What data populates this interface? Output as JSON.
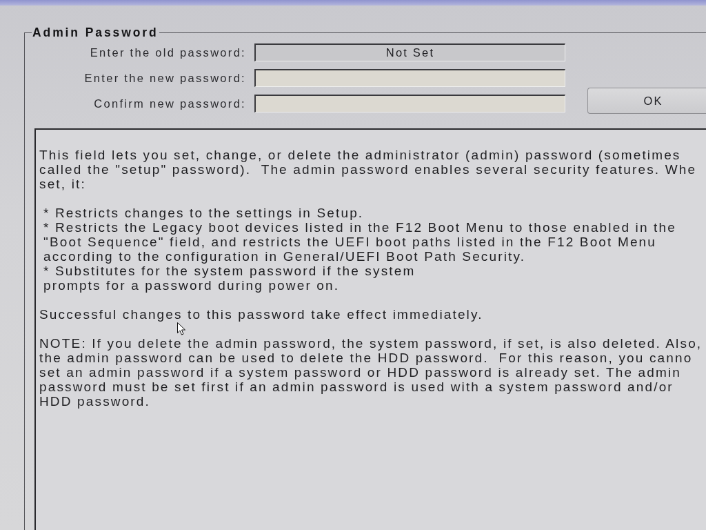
{
  "group": {
    "title": "Admin Password"
  },
  "fields": [
    {
      "label": "Enter the old password:",
      "value": "Not Set",
      "disabled": true
    },
    {
      "label": "Enter the new password:",
      "disabled": false
    },
    {
      "label": "Confirm new password:",
      "disabled": false
    }
  ],
  "ok_button": {
    "label": "OK"
  },
  "help": {
    "paragraphs": [
      {
        "kind": "text",
        "lines": [
          "This field lets you set, change, or delete the administrator (admin) password (sometimes",
          "called the \"setup\" password).  The admin password enables several security features. Whe",
          "set, it:"
        ]
      },
      {
        "kind": "bullets",
        "lines": [
          "* Restricts changes to the settings in Setup.",
          "* Restricts the Legacy boot devices listed in the F12 Boot Menu to those enabled in the",
          "\"Boot Sequence\" field, and restricts the UEFI boot paths listed in the F12 Boot Menu",
          "according to the configuration in General/UEFI Boot Path Security.",
          "* Substitutes for the system password if the system",
          "prompts for a password during power on."
        ]
      },
      {
        "kind": "text",
        "lines": [
          "Successful changes to this password take effect immediately."
        ]
      },
      {
        "kind": "text",
        "lines": [
          "NOTE: If you delete the admin password, the system password, if set, is also deleted. Also,",
          "the admin password can be used to delete the HDD password.  For this reason, you canno",
          "set an admin password if a system password or HDD password is already set. The admin",
          "password must be set first if an admin password is used with a system password and/or",
          "HDD password."
        ]
      }
    ]
  }
}
